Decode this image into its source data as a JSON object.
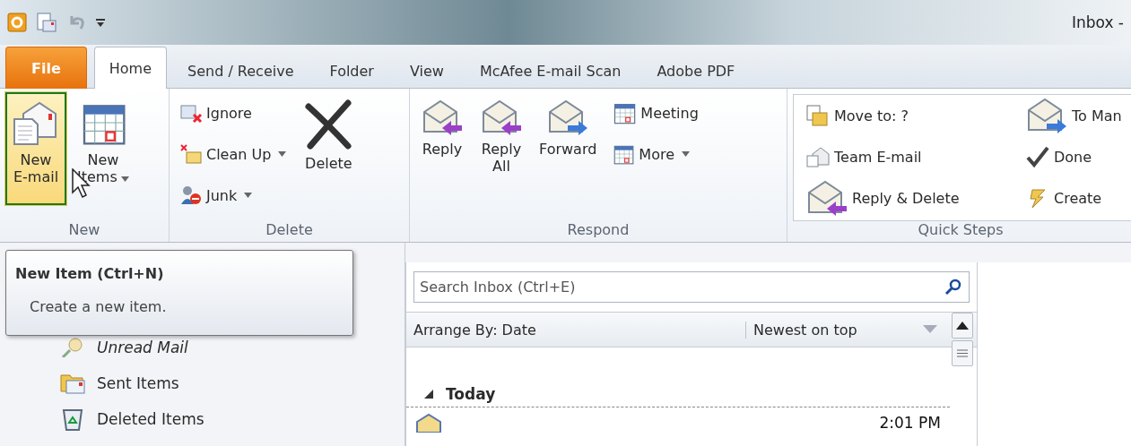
{
  "window": {
    "title": "Inbox -"
  },
  "tabs": [
    {
      "label": "File",
      "kind": "file",
      "selected": false
    },
    {
      "label": "Home",
      "kind": "tab",
      "selected": true
    },
    {
      "label": "Send / Receive",
      "kind": "tab",
      "selected": false
    },
    {
      "label": "Folder",
      "kind": "tab",
      "selected": false
    },
    {
      "label": "View",
      "kind": "tab",
      "selected": false
    },
    {
      "label": "McAfee E-mail Scan",
      "kind": "tab",
      "selected": false
    },
    {
      "label": "Adobe PDF",
      "kind": "tab",
      "selected": false
    }
  ],
  "ribbon": {
    "groups": [
      {
        "label": "New",
        "kind": "plain",
        "buttons": [
          {
            "label": "New\nE-mail",
            "kind": "large",
            "has_menu": false,
            "highlighted": true
          },
          {
            "label": "New\nItems",
            "kind": "large",
            "has_menu": true,
            "highlighted": false
          }
        ]
      },
      {
        "label": "Delete",
        "kind": "plain",
        "buttons": [
          {
            "label": "Ignore",
            "kind": "small",
            "has_menu": false,
            "highlighted": false
          },
          {
            "label": "Clean Up",
            "kind": "small",
            "has_menu": true,
            "highlighted": false
          },
          {
            "label": "Junk",
            "kind": "small",
            "has_menu": true,
            "highlighted": false
          },
          {
            "label": "Delete",
            "kind": "large",
            "has_menu": false,
            "highlighted": false
          }
        ]
      },
      {
        "label": "Respond",
        "kind": "plain",
        "buttons": [
          {
            "label": "Reply",
            "kind": "large",
            "has_menu": false,
            "highlighted": false
          },
          {
            "label": "Reply\nAll",
            "kind": "large",
            "has_menu": false,
            "highlighted": false
          },
          {
            "label": "Forward",
            "kind": "large",
            "has_menu": false,
            "highlighted": false
          },
          {
            "label": "Meeting",
            "kind": "small",
            "has_menu": false,
            "highlighted": false
          },
          {
            "label": "More",
            "kind": "small",
            "has_menu": true,
            "highlighted": false
          }
        ]
      },
      {
        "label": "Quick Steps",
        "kind": "gallery",
        "buttons": [
          {
            "label": "Move to: ?",
            "kind": "small",
            "has_menu": false,
            "highlighted": false
          },
          {
            "label": "Team E-mail",
            "kind": "small",
            "has_menu": false,
            "highlighted": false
          },
          {
            "label": "Reply & Delete",
            "kind": "small",
            "has_menu": false,
            "highlighted": false
          },
          {
            "label": "To Man",
            "kind": "small",
            "has_menu": false,
            "highlighted": false
          },
          {
            "label": "Done",
            "kind": "small",
            "has_menu": false,
            "highlighted": false
          },
          {
            "label": "Create",
            "kind": "small",
            "has_menu": false,
            "highlighted": false
          }
        ]
      }
    ]
  },
  "tooltip": {
    "title": "New Item (Ctrl+N)",
    "description": "Create a new item."
  },
  "folders": [
    {
      "label": "Unread Mail"
    },
    {
      "label": "Sent Items"
    },
    {
      "label": "Deleted Items"
    }
  ],
  "mail_list": {
    "search": {
      "placeholder": "Search Inbox (Ctrl+E)"
    },
    "arrange_by": "Arrange By: Date",
    "sort": "Newest on top",
    "groups": [
      {
        "label": "Today",
        "expanded": true,
        "messages": [
          {
            "time": "2:01 PM",
            "unread": false
          }
        ]
      }
    ]
  }
}
